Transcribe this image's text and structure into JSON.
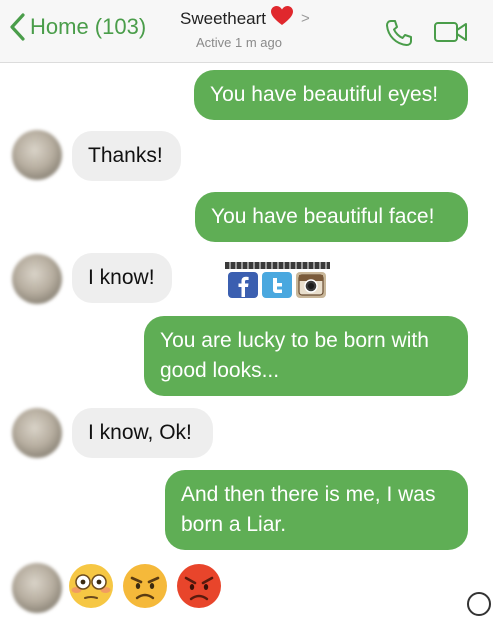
{
  "header": {
    "back_label": "Home (103)",
    "contact_name": "Sweetheart",
    "status": "Active 1 m ago",
    "chevron": ">"
  },
  "messages": [
    {
      "side": "out",
      "text": "You have beautiful eyes!"
    },
    {
      "side": "in",
      "text": "Thanks!"
    },
    {
      "side": "out",
      "text": "You have beautiful face!"
    },
    {
      "side": "in",
      "text": "I know!"
    },
    {
      "side": "out",
      "text": "You are lucky to be born with good looks..."
    },
    {
      "side": "in",
      "text": "I know, Ok!"
    },
    {
      "side": "out",
      "text": "And then there is me, I was born a Liar."
    }
  ],
  "reactions": [
    "flushed-face",
    "angry-face",
    "pouting-face"
  ],
  "icons": {
    "back": "chevron-left-icon",
    "call": "phone-icon",
    "video": "video-camera-icon",
    "heart": "red-heart-icon"
  },
  "colors": {
    "accent": "#4a9d4a",
    "outgoing_bubble": "#5fae55",
    "incoming_bubble": "#eeeeee",
    "heart": "#e0282d"
  }
}
